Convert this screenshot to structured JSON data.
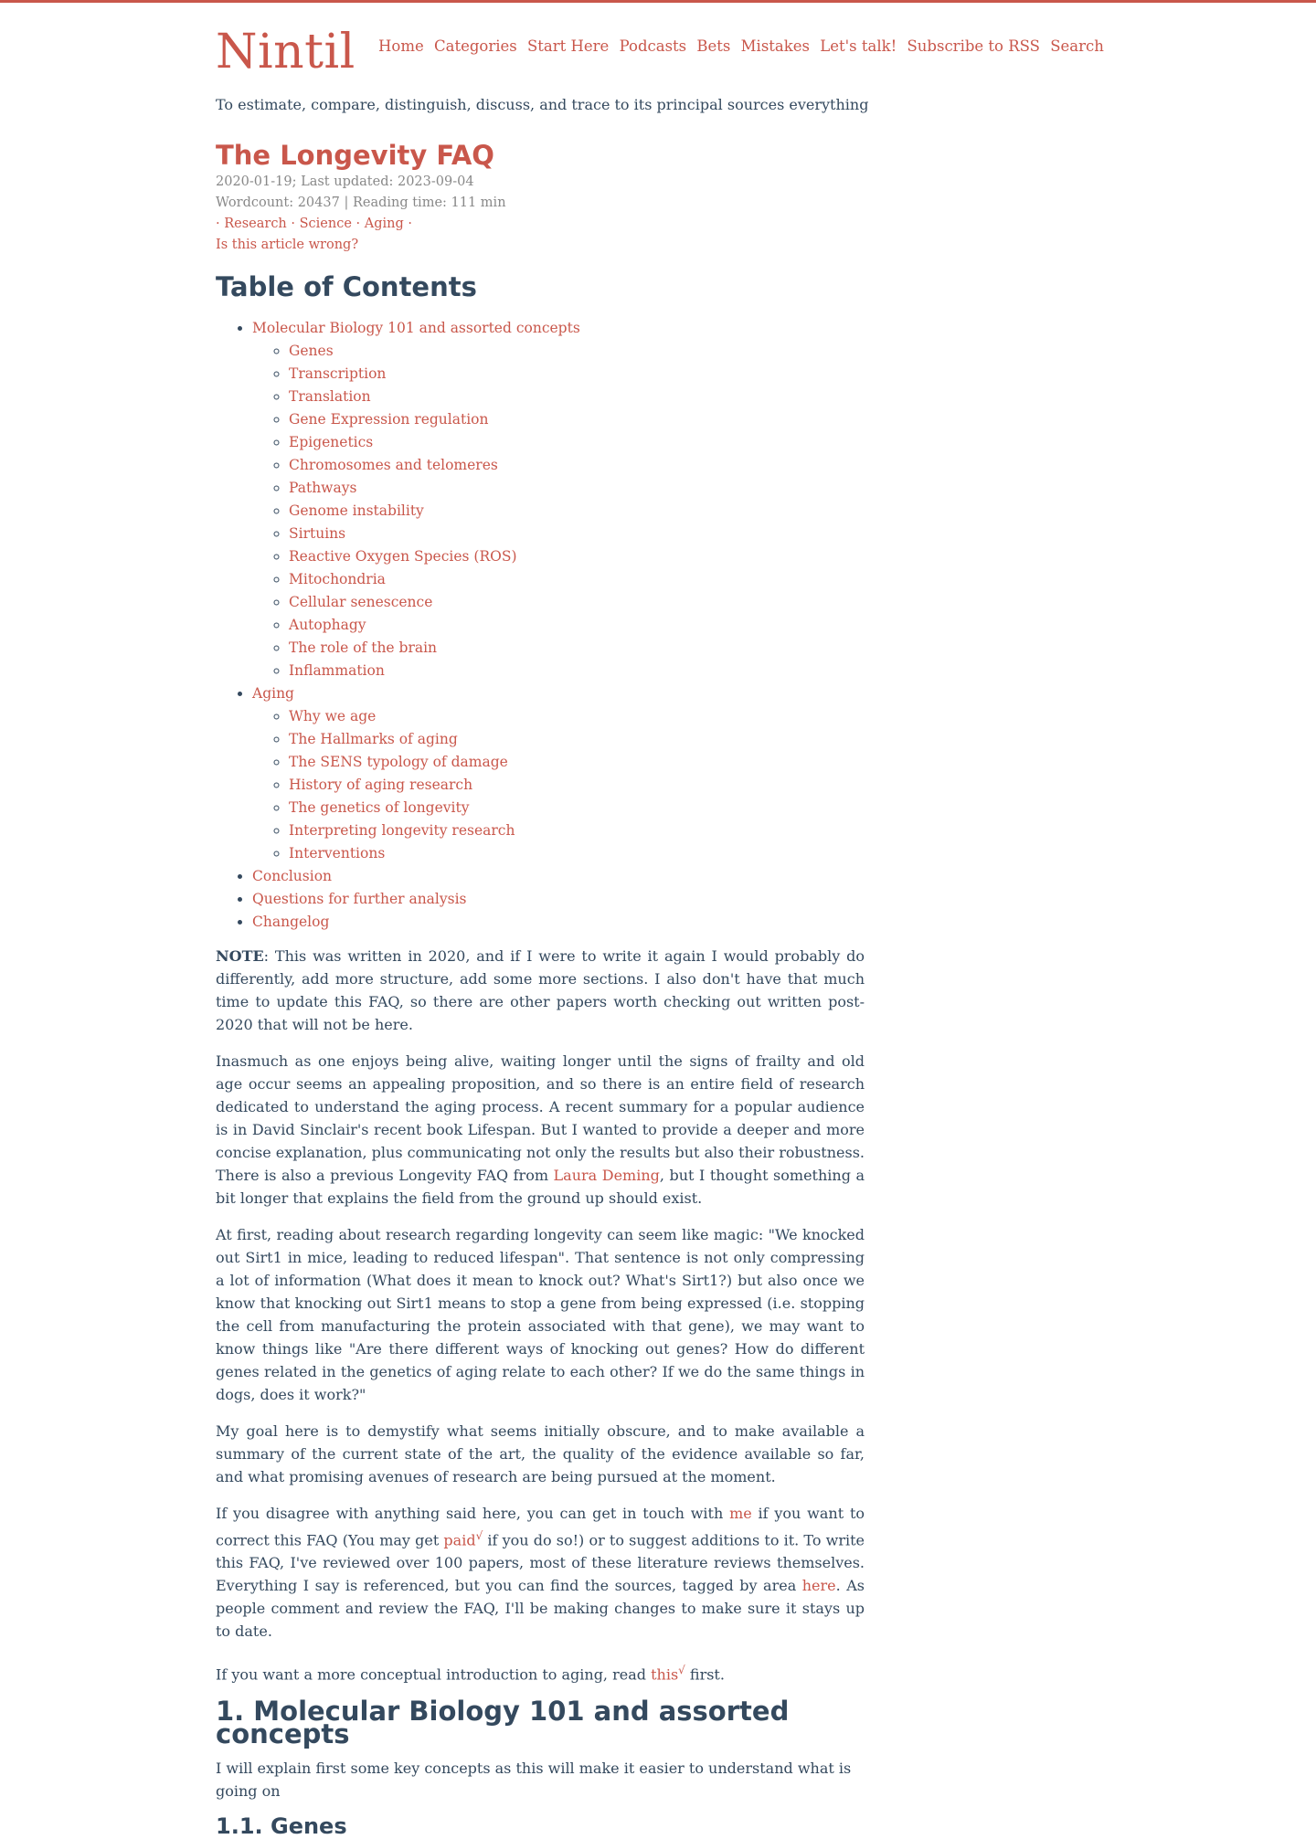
{
  "site": {
    "logo": "Nintil",
    "nav": [
      "Home",
      "Categories",
      "Start Here",
      "Podcasts",
      "Bets",
      "Mistakes",
      "Let's talk!",
      "Subscribe to RSS",
      "Search"
    ],
    "tagline": "To estimate, compare, distinguish, discuss, and trace to its principal sources everything"
  },
  "post": {
    "title": "The Longevity FAQ",
    "dates": "2020-01-19; Last updated: 2023-09-04",
    "stats": "Wordcount: 20437 | Reading time: 111 min",
    "tag_sep": "·",
    "tags": [
      "Research",
      "Science",
      "Aging"
    ],
    "wrong_link": "Is this article wrong?"
  },
  "toc": {
    "title": "Table of Contents",
    "sections": [
      {
        "label": "Molecular Biology 101 and assorted concepts",
        "children": [
          "Genes",
          "Transcription",
          "Translation",
          "Gene Expression regulation",
          "Epigenetics",
          "Chromosomes and telomeres",
          "Pathways",
          "Genome instability",
          "Sirtuins",
          "Reactive Oxygen Species (ROS)",
          "Mitochondria",
          "Cellular senescence",
          "Autophagy",
          "The role of the brain",
          "Inflammation"
        ]
      },
      {
        "label": "Aging",
        "children": [
          "Why we age",
          "The Hallmarks of aging",
          "The SENS typology of damage",
          "History of aging research",
          "The genetics of longevity",
          "Interpreting longevity research",
          "Interventions"
        ]
      },
      {
        "label": "Conclusion",
        "children": []
      },
      {
        "label": "Questions for further analysis",
        "children": []
      },
      {
        "label": "Changelog",
        "children": []
      }
    ]
  },
  "body": {
    "note_label": "NOTE",
    "note_text": ": This was written in 2020, and if I were to write it again I would probably do differently, add more structure, add some more sections. I also don't have that much time to update this FAQ, so there are other papers worth checking out written post-2020 that will not be here.",
    "p1_before": "Inasmuch as one enjoys being alive, waiting longer until the signs of frailty and old age occur seems an appealing proposition, and so there is an entire field of research dedicated to understand the aging process. A recent summary for a popular audience is in David Sinclair's recent book Lifespan. But I wanted to provide a deeper and more concise explanation, plus communicating not only the results but also their robustness. There is also a previous Longevity FAQ from ",
    "p1_link": "Laura Deming",
    "p1_after": ", but I thought something a bit longer that explains the field from the ground up should exist.",
    "p2": "At first, reading about research regarding longevity can seem like magic: \"We knocked out Sirt1 in mice, leading to reduced lifespan\". That sentence is not only compressing a lot of information (What does it mean to knock out? What's Sirt1?) but also once we know that knocking out Sirt1 means to stop a gene from being expressed (i.e. stopping the cell from manufacturing the protein associated with that gene), we may want to know things like \"Are there different ways of knocking out genes? How do different genes related in the genetics of aging relate to each other? If we do the same things in dogs, does it work?\"",
    "p3": "My goal here is to demystify what seems initially obscure, and to make available a summary of the current state of the art, the quality of the evidence available so far, and what promising avenues of research are being pursued at the moment.",
    "p4_a": "If you disagree with anything said here, you can get in touch with ",
    "p4_link1": "me",
    "p4_b": " if you want to correct this FAQ (You may get ",
    "p4_link2": "paid",
    "p4_sup": "√",
    "p4_c": " if you do so!) or to suggest additions to it. To write this FAQ, I've reviewed over 100 papers, most of these literature reviews themselves. Everything I say is referenced, but you can find the sources, tagged by area ",
    "p4_link3": "here",
    "p4_d": ". As people comment and review the FAQ, I'll be making changes to make sure it stays up to date.",
    "p5_a": "If you want a more conceptual introduction to aging, read ",
    "p5_link": "this",
    "p5_sup": "√",
    "p5_b": " first.",
    "h1": "1. Molecular Biology 101 and assorted concepts",
    "h1_intro": "I will explain first some key concepts as this will make it easier to understand what is going on",
    "h2": "1.1. Genes"
  }
}
